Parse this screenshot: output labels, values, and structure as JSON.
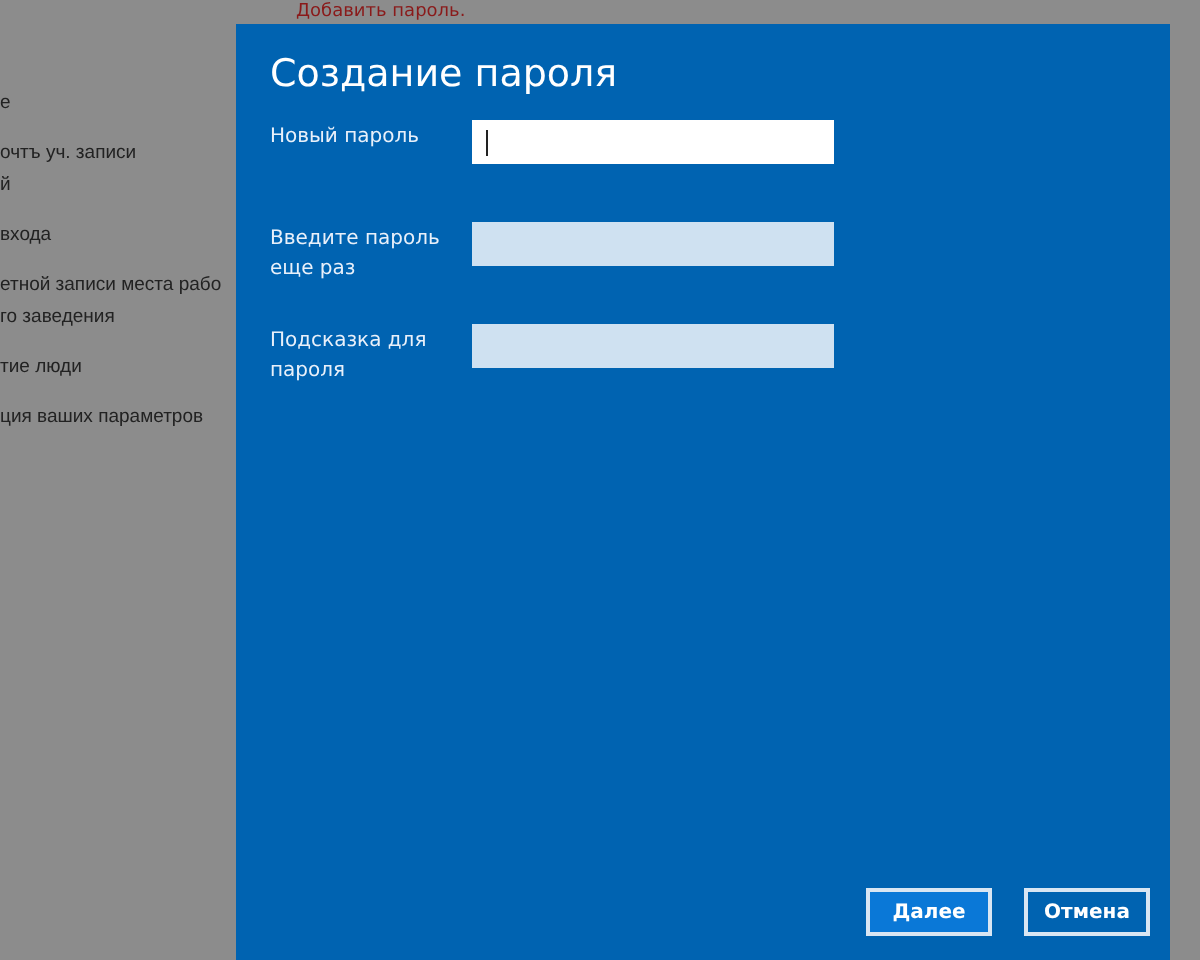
{
  "background": {
    "notice": "Добавить пароль.",
    "items": [
      [
        "е"
      ],
      [
        "очтъ уч. записи",
        "й"
      ],
      [
        "входа"
      ],
      [
        "етной записи места рабо",
        "го заведения"
      ],
      [
        "тие люди"
      ],
      [
        "ция ваших параметров"
      ]
    ]
  },
  "dialog": {
    "title": "Создание пароля",
    "fields": [
      {
        "label": "Новый пароль",
        "focused": true
      },
      {
        "label": "Введите пароль еще раз",
        "focused": false
      },
      {
        "label": "Подсказка для пароля",
        "focused": false
      }
    ],
    "buttons": [
      {
        "label": "Далее",
        "selected": true
      },
      {
        "label": "Отмена",
        "selected": false
      }
    ]
  }
}
